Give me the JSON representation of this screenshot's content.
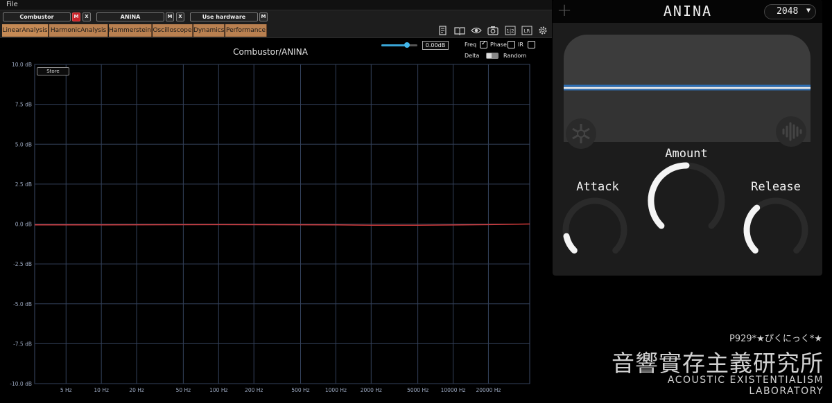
{
  "menubar": {
    "file_label": "File"
  },
  "plugin_slots": [
    {
      "name": "Combustor",
      "buttons": [
        "M",
        "X"
      ],
      "mute_active": true
    },
    {
      "name": "ANINA",
      "buttons": [
        "M",
        "X"
      ],
      "mute_active": false
    },
    {
      "name": "Use hardware",
      "buttons": [
        "M"
      ],
      "mute_active": false
    }
  ],
  "tabs": [
    "LinearAnalysis",
    "HarmonicAnalysis",
    "Hammerstein",
    "Oscilloscope",
    "Dynamics",
    "Performance"
  ],
  "active_tab": "LinearAnalysis",
  "toolbar_icons": [
    "notes-icon",
    "book-icon",
    "eye-icon",
    "camera-icon",
    "channel-icon",
    "lr-icon",
    "gear-icon"
  ],
  "toolbar": {
    "channel_label": "1|2",
    "lr_label": "LR"
  },
  "analyzer": {
    "title": "Combustor/ANINA",
    "gain_value": "0.00dB",
    "gain_fraction": 0.7,
    "store_label": "Store",
    "options": {
      "freq": {
        "label": "Freq",
        "checked": true
      },
      "phase": {
        "label": "Phase",
        "checked": false
      },
      "ir": {
        "label": "IR",
        "checked": false
      },
      "delta": {
        "label": "Delta"
      },
      "random": {
        "label": "Random"
      }
    }
  },
  "chart_data": {
    "type": "line",
    "title": "Combustor/ANINA",
    "xscale": "log",
    "xlim": [
      2.7,
      45000
    ],
    "ylim": [
      -10,
      10
    ],
    "y_ticks": [
      10,
      7.5,
      5,
      2.5,
      0,
      -2.5,
      -5,
      -7.5,
      -10
    ],
    "y_tick_labels": [
      "10.0 dB",
      "7.5 dB",
      "5.0 dB",
      "2.5 dB",
      "0.0 dB",
      "-2.5 dB",
      "-5.0 dB",
      "-7.5 dB",
      "-10.0 dB"
    ],
    "x_ticks": [
      5,
      10,
      20,
      50,
      100,
      200,
      500,
      1000,
      2000,
      5000,
      10000,
      20000
    ],
    "x_tick_labels": [
      "5 Hz",
      "10 Hz",
      "20 Hz",
      "50 Hz",
      "100 Hz",
      "200 Hz",
      "500 Hz",
      "1000 Hz",
      "2000 Hz",
      "5000 Hz",
      "10000 Hz",
      "20000 Hz"
    ],
    "grid": true,
    "series": [
      {
        "color": "#d33a3a",
        "x": [
          2.7,
          10,
          100,
          1000,
          2000,
          5000,
          10000,
          20000,
          45000
        ],
        "y": [
          -0.05,
          -0.05,
          -0.04,
          -0.05,
          -0.08,
          -0.08,
          -0.06,
          -0.04,
          0.0
        ]
      }
    ]
  },
  "plugin": {
    "title": "ANINA",
    "size_value": "2048",
    "plus_icon": "plus-icon",
    "freeze_icon": "snowflake-icon",
    "wave_icon": "waveform-icon",
    "knobs": [
      {
        "label": "Attack",
        "value": 0.12
      },
      {
        "label": "Amount",
        "value": 0.5
      },
      {
        "label": "Release",
        "value": 0.35
      }
    ]
  },
  "watermark": {
    "line1": "P929*★ぴくにっく*★",
    "line2": "音響實存主義研究所",
    "line3": "ACOUSTIC EXISTENTIALISM LABORATORY"
  },
  "colors": {
    "accent": "#3aa6d8",
    "tab": "#b98050",
    "trace": "#d33a3a",
    "mute_active": "#c9232a"
  }
}
